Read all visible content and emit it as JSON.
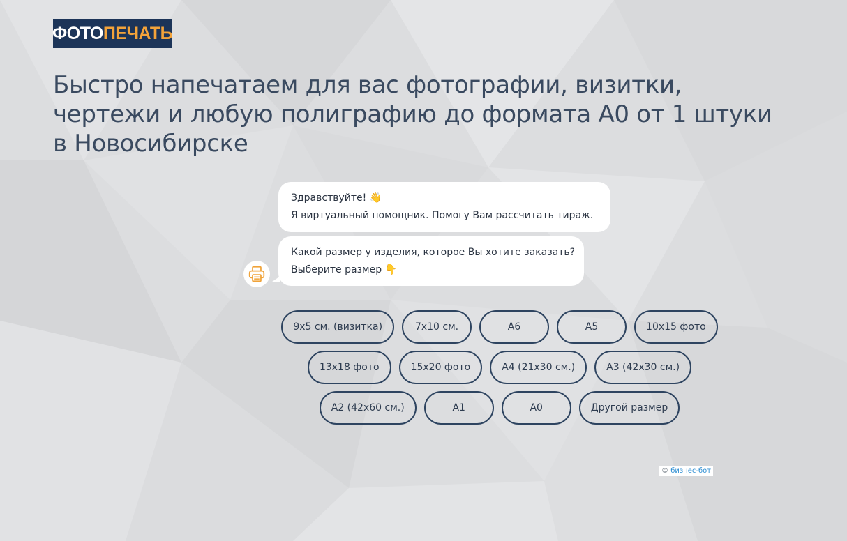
{
  "logo": {
    "part1": "ФОТО",
    "part2": "ПЕЧАТЬ"
  },
  "headline": {
    "line1": "Быстро напечатаем для вас фотографии, визитки,",
    "line2": "чертежи и любую полиграфию до формата А0 от 1 штуки",
    "line3": "в Новосибирске"
  },
  "chat": {
    "greeting": {
      "line1": "Здравствуйте! 👋",
      "line2": "Я виртуальный помощник. Помогу Вам рассчитать тираж."
    },
    "question": {
      "line1": "Какой размер у изделия, которое Вы хотите заказать?",
      "line2": "Выберите размер 👇"
    },
    "avatar_icon": "printer-icon"
  },
  "options": {
    "row1": [
      "9x5 см. (визитка)",
      "7x10 см.",
      "А6",
      "А5",
      "10x15 фото"
    ],
    "row2": [
      "13x18 фото",
      "15x20 фото",
      "А4 (21x30 см.)",
      "А3 (42x30 см.)"
    ],
    "row3": [
      "А2 (42x60 см.)",
      "А1",
      "А0",
      "Другой размер"
    ]
  },
  "credit": {
    "copyright": "©",
    "link": "бизнес-бот"
  },
  "colors": {
    "brand_navy": "#1c3458",
    "brand_orange": "#f3a33a",
    "button_border": "#2e4460",
    "link": "#2f8fd3"
  }
}
